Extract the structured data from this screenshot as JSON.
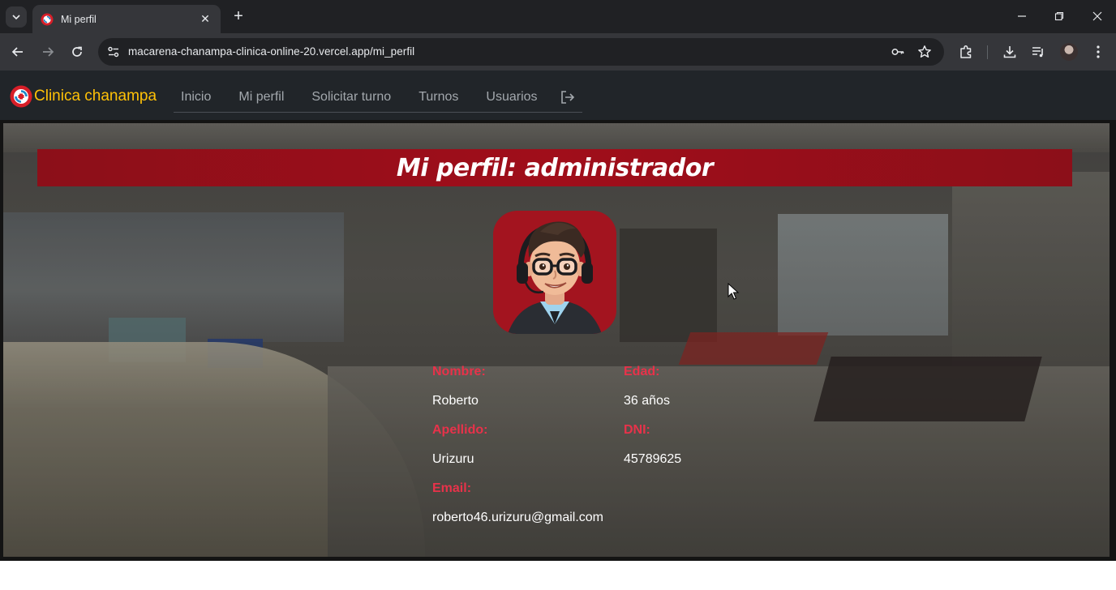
{
  "browser": {
    "tab_title": "Mi perfil",
    "url": "macarena-chanampa-clinica-online-20.vercel.app/mi_perfil"
  },
  "navbar": {
    "brand": "Clinica chanampa",
    "links": [
      "Inicio",
      "Mi perfil",
      "Solicitar turno",
      "Turnos",
      "Usuarios"
    ]
  },
  "profile": {
    "heading": "Mi perfil: administrador",
    "fields": {
      "nombre_label": "Nombre:",
      "nombre_value": "Roberto",
      "edad_label": "Edad:",
      "edad_value": "36 años",
      "apellido_label": "Apellido:",
      "apellido_value": "Urizuru",
      "dni_label": "DNI:",
      "dni_value": "45789625",
      "email_label": "Email:",
      "email_value": "roberto46.urizuru@gmail.com"
    }
  },
  "colors": {
    "brand": "#ffc107",
    "banner": "#9a0e19",
    "label": "#e8324a"
  }
}
